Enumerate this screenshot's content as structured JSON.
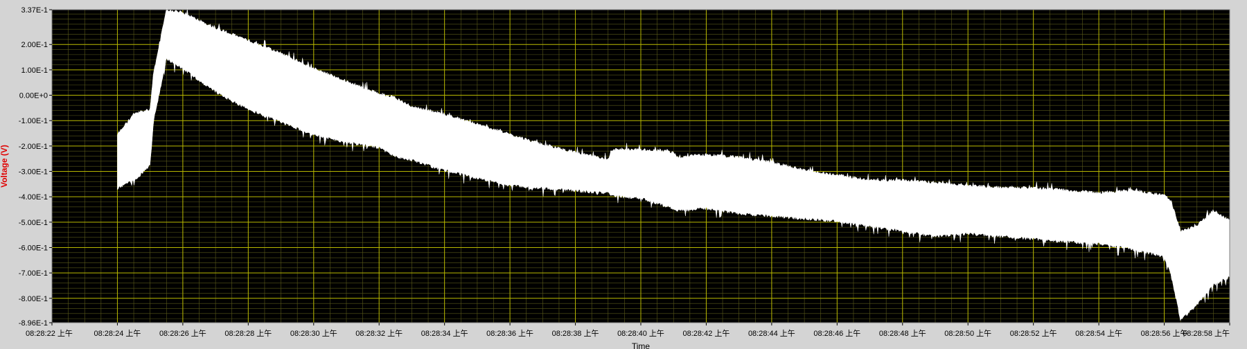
{
  "chart_data": {
    "type": "area",
    "title": "",
    "xlabel": "Time",
    "ylabel": "Voltage (V)",
    "grid": true,
    "colors": {
      "plot_bg": "#000000",
      "frame_bg": "#d4d4d4",
      "major_grid": "#b8b800",
      "minor_grid": "#5a5a1a",
      "trace": "#ffffff",
      "ylabel_color": "#e00000"
    },
    "x_ticks": [
      "08:28:22 上午",
      "08:28:24 上午",
      "08:28:26 上午",
      "08:28:28 上午",
      "08:28:30 上午",
      "08:28:32 上午",
      "08:28:34 上午",
      "08:28:36 上午",
      "08:28:38 上午",
      "08:28:40 上午",
      "08:28:42 上午",
      "08:28:44 上午",
      "08:28:46 上午",
      "08:28:48 上午",
      "08:28:50 上午",
      "08:28:52 上午",
      "08:28:54 上午",
      "08:28:56 上午",
      "08:28:58 上午"
    ],
    "y_ticks": [
      {
        "v": 0.337,
        "label": "3.37E-1"
      },
      {
        "v": 0.2,
        "label": "2.00E-1"
      },
      {
        "v": 0.1,
        "label": "1.00E-1"
      },
      {
        "v": 0.0,
        "label": "0.00E+0"
      },
      {
        "v": -0.1,
        "label": "-1.00E-1"
      },
      {
        "v": -0.2,
        "label": "-2.00E-1"
      },
      {
        "v": -0.3,
        "label": "-3.00E-1"
      },
      {
        "v": -0.4,
        "label": "-4.00E-1"
      },
      {
        "v": -0.5,
        "label": "-5.00E-1"
      },
      {
        "v": -0.6,
        "label": "-6.00E-1"
      },
      {
        "v": -0.7,
        "label": "-7.00E-1"
      },
      {
        "v": -0.8,
        "label": "-8.00E-1"
      },
      {
        "v": -0.896,
        "label": "-8.96E-1"
      }
    ],
    "xlim_seconds": [
      22,
      58
    ],
    "ylim": [
      -0.896,
      0.337
    ],
    "series": [
      {
        "x_seconds": [
          24.0,
          24.5,
          25.0,
          25.1,
          25.5,
          26.0,
          27.0,
          28.0,
          29.0,
          30.0,
          31.0,
          32.0,
          32.4,
          33.0,
          34.0,
          35.0,
          36.0,
          37.0,
          38.0,
          39.0,
          39.1,
          40.0,
          41.0,
          41.1,
          42.0,
          43.0,
          44.0,
          45.0,
          46.0,
          47.0,
          48.0,
          49.0,
          50.0,
          51.0,
          52.0,
          53.0,
          54.0,
          55.0,
          56.0,
          56.2,
          56.5,
          57.0,
          57.5,
          58.0
        ],
        "upper": [
          -0.16,
          -0.08,
          -0.06,
          0.08,
          0.33,
          0.32,
          0.26,
          0.21,
          0.16,
          0.1,
          0.05,
          0.0,
          -0.01,
          -0.05,
          -0.08,
          -0.12,
          -0.16,
          -0.2,
          -0.23,
          -0.26,
          -0.22,
          -0.22,
          -0.23,
          -0.25,
          -0.24,
          -0.25,
          -0.27,
          -0.3,
          -0.32,
          -0.34,
          -0.34,
          -0.35,
          -0.36,
          -0.37,
          -0.37,
          -0.38,
          -0.39,
          -0.38,
          -0.4,
          -0.42,
          -0.54,
          -0.52,
          -0.46,
          -0.5
        ],
        "lower": [
          -0.36,
          -0.33,
          -0.27,
          -0.1,
          0.15,
          0.11,
          0.02,
          -0.05,
          -0.1,
          -0.15,
          -0.18,
          -0.2,
          -0.23,
          -0.25,
          -0.29,
          -0.32,
          -0.35,
          -0.36,
          -0.37,
          -0.38,
          -0.39,
          -0.4,
          -0.44,
          -0.45,
          -0.44,
          -0.46,
          -0.47,
          -0.48,
          -0.49,
          -0.51,
          -0.53,
          -0.55,
          -0.54,
          -0.55,
          -0.56,
          -0.57,
          -0.58,
          -0.6,
          -0.63,
          -0.7,
          -0.88,
          -0.82,
          -0.74,
          -0.71
        ]
      }
    ]
  }
}
